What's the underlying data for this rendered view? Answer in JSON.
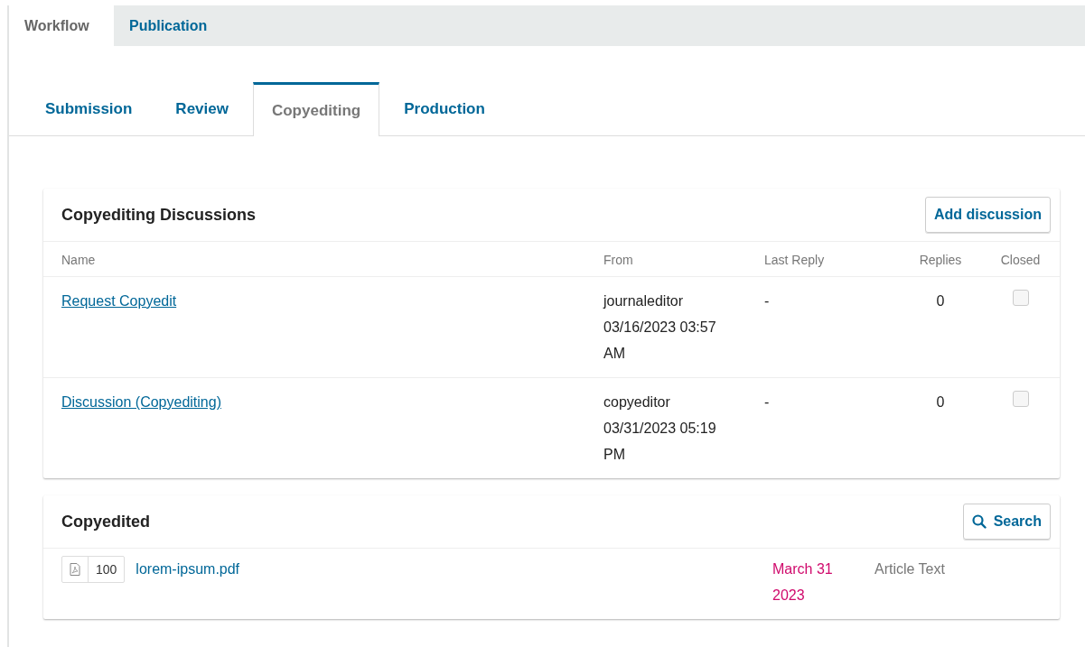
{
  "primary_tabs": [
    {
      "label": "Workflow",
      "selected": true
    },
    {
      "label": "Publication",
      "selected": false
    }
  ],
  "stage_tabs": [
    {
      "label": "Submission",
      "selected": false
    },
    {
      "label": "Review",
      "selected": false
    },
    {
      "label": "Copyediting",
      "selected": true
    },
    {
      "label": "Production",
      "selected": false
    }
  ],
  "discussions": {
    "title": "Copyediting Discussions",
    "add_button": "Add discussion",
    "columns": [
      "Name",
      "From",
      "Last Reply",
      "Replies",
      "Closed"
    ],
    "rows": [
      {
        "name": "Request Copyedit",
        "user": "journaleditor",
        "date": "03/16/2023 03:57 AM",
        "last_reply": "-",
        "replies": "0",
        "closed": false
      },
      {
        "name": "Discussion (Copyediting)",
        "user": "copyeditor",
        "date": "03/31/2023 05:19 PM",
        "last_reply": "-",
        "replies": "0",
        "closed": false
      }
    ]
  },
  "files": {
    "title": "Copyedited",
    "search_button": "Search",
    "items": [
      {
        "id": "100",
        "name": "lorem-ipsum.pdf",
        "date": "March 31 2023",
        "genre": "Article Text"
      }
    ]
  }
}
